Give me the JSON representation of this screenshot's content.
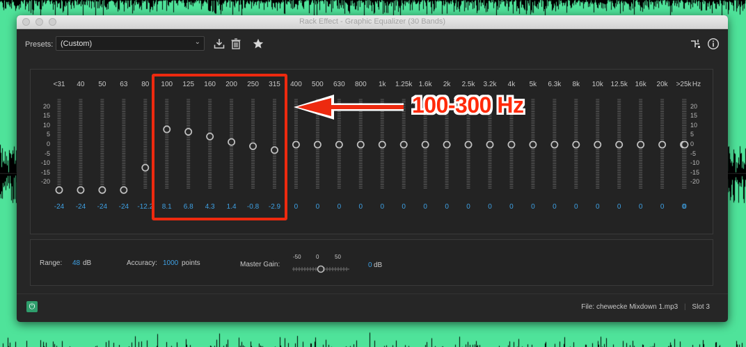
{
  "window": {
    "title": "Rack Effect - Graphic Equalizer (30 Bands)"
  },
  "toolbar": {
    "presets_label": "Presets:",
    "preset_value": "(Custom)",
    "icons": [
      "save-preset-icon",
      "delete-preset-icon",
      "favorite-star-icon",
      "routing-icon",
      "info-icon"
    ]
  },
  "eq": {
    "bands": [
      {
        "freq": "<31",
        "gain": -24,
        "label": "-24"
      },
      {
        "freq": "40",
        "gain": -24,
        "label": "-24"
      },
      {
        "freq": "50",
        "gain": -24,
        "label": "-24"
      },
      {
        "freq": "63",
        "gain": -24,
        "label": "-24"
      },
      {
        "freq": "80",
        "gain": -12.2,
        "label": "-12.2"
      },
      {
        "freq": "100",
        "gain": 8.1,
        "label": "8.1"
      },
      {
        "freq": "125",
        "gain": 6.8,
        "label": "6.8"
      },
      {
        "freq": "160",
        "gain": 4.3,
        "label": "4.3"
      },
      {
        "freq": "200",
        "gain": 1.4,
        "label": "1.4"
      },
      {
        "freq": "250",
        "gain": -0.8,
        "label": "-0.8"
      },
      {
        "freq": "315",
        "gain": -2.9,
        "label": "-2.9"
      },
      {
        "freq": "400",
        "gain": 0,
        "label": "0"
      },
      {
        "freq": "500",
        "gain": 0,
        "label": "0"
      },
      {
        "freq": "630",
        "gain": 0,
        "label": "0"
      },
      {
        "freq": "800",
        "gain": 0,
        "label": "0"
      },
      {
        "freq": "1k",
        "gain": 0,
        "label": "0"
      },
      {
        "freq": "1.25k",
        "gain": 0,
        "label": "0"
      },
      {
        "freq": "1.6k",
        "gain": 0,
        "label": "0"
      },
      {
        "freq": "2k",
        "gain": 0,
        "label": "0"
      },
      {
        "freq": "2.5k",
        "gain": 0,
        "label": "0"
      },
      {
        "freq": "3.2k",
        "gain": 0,
        "label": "0"
      },
      {
        "freq": "4k",
        "gain": 0,
        "label": "0"
      },
      {
        "freq": "5k",
        "gain": 0,
        "label": "0"
      },
      {
        "freq": "6.3k",
        "gain": 0,
        "label": "0"
      },
      {
        "freq": "8k",
        "gain": 0,
        "label": "0"
      },
      {
        "freq": "10k",
        "gain": 0,
        "label": "0"
      },
      {
        "freq": "12.5k",
        "gain": 0,
        "label": "0"
      },
      {
        "freq": "16k",
        "gain": 0,
        "label": "0"
      },
      {
        "freq": "20k",
        "gain": 0,
        "label": "0"
      },
      {
        "freq": ">25k",
        "gain": 0,
        "label": "0"
      }
    ],
    "master": {
      "freq": "Hz",
      "gain": 0,
      "label": "0"
    },
    "scale_left": [
      "20",
      "15",
      "10",
      "5",
      "0",
      "-5",
      "-10",
      "-15",
      "-20"
    ],
    "scale_right": [
      "20",
      "15",
      "10",
      "5",
      "0",
      "-5",
      "-10",
      "-15",
      "-20"
    ],
    "gain_range": [
      -24,
      24
    ]
  },
  "settings": {
    "range_label": "Range:",
    "range_value": "48",
    "range_unit": "dB",
    "accuracy_label": "Accuracy:",
    "accuracy_value": "1000",
    "accuracy_unit": "points",
    "master_gain_label": "Master Gain:",
    "master_gain_min": "-50",
    "master_gain_mid": "0",
    "master_gain_max": "50",
    "master_gain_value": "0",
    "master_gain_unit": "dB",
    "master_gain_level": 0
  },
  "status": {
    "file": "File: chewecke Mixdown 1.mp3",
    "slot": "Slot 3"
  },
  "annotation": {
    "text": "100-300 Hz"
  },
  "colors": {
    "window_bg": "#262626",
    "value_blue": "#3ea0e3",
    "annotation_red": "#ed2a0f",
    "waveform_green": "#4fe39a"
  }
}
